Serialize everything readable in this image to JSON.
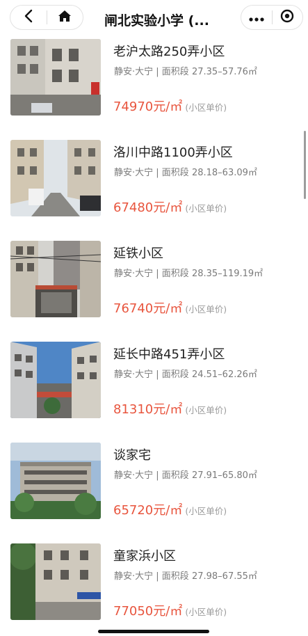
{
  "header": {
    "title": "闸北实验小学 (...",
    "back_icon": "chevron-left-icon",
    "home_icon": "home-icon",
    "more_icon": "more-dots-icon",
    "close_icon": "target-close-icon"
  },
  "colors": {
    "price": "#e8553e",
    "meta": "#7a7a7a",
    "note": "#9a9a9a"
  },
  "listings": [
    {
      "name": "老沪太路250弄小区",
      "location": "静安·大宁",
      "area_label": "面积段",
      "area": "27.35–57.76㎡",
      "price": "74970元/㎡",
      "price_note": "(小区单价)"
    },
    {
      "name": "洛川中路1100弄小区",
      "location": "静安·大宁",
      "area_label": "面积段",
      "area": "28.18–63.09㎡",
      "price": "67480元/㎡",
      "price_note": "(小区单价)"
    },
    {
      "name": "延铁小区",
      "location": "静安·大宁",
      "area_label": "面积段",
      "area": "28.35–119.19㎡",
      "price": "76740元/㎡",
      "price_note": "(小区单价)"
    },
    {
      "name": "延长中路451弄小区",
      "location": "静安·大宁",
      "area_label": "面积段",
      "area": "24.51–62.26㎡",
      "price": "81310元/㎡",
      "price_note": "(小区单价)"
    },
    {
      "name": "谈家宅",
      "location": "静安·大宁",
      "area_label": "面积段",
      "area": "27.91–65.80㎡",
      "price": "65720元/㎡",
      "price_note": "(小区单价)"
    },
    {
      "name": "童家浜小区",
      "location": "静安·大宁",
      "area_label": "面积段",
      "area": "27.98–67.55㎡",
      "price": "77050元/㎡",
      "price_note": "(小区单价)"
    }
  ]
}
